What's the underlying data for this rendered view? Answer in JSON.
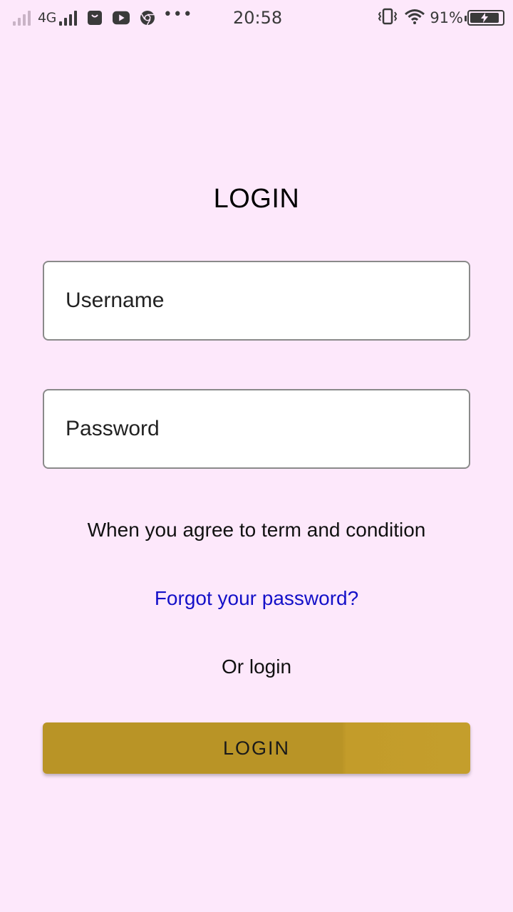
{
  "status_bar": {
    "network_type": "4G",
    "time": "20:58",
    "battery_percent": "91%",
    "battery_level": 0.91,
    "notification_icons": [
      "shopping-bag-icon",
      "youtube-icon",
      "chrome-icon",
      "more-dots-icon"
    ],
    "right_icons": [
      "vibrate-icon",
      "wifi-icon"
    ]
  },
  "login_screen": {
    "title": "LOGIN",
    "username_placeholder": "Username",
    "password_placeholder": "Password",
    "terms_text": "When you agree to term and condition",
    "forgot_password_link": "Forgot your password?",
    "or_login_text": "Or login",
    "login_button_label": "LOGIN"
  },
  "colors": {
    "background": "#fde8fb",
    "link": "#1410c8",
    "button": "#b99426",
    "field_border": "#8a8a8a"
  }
}
